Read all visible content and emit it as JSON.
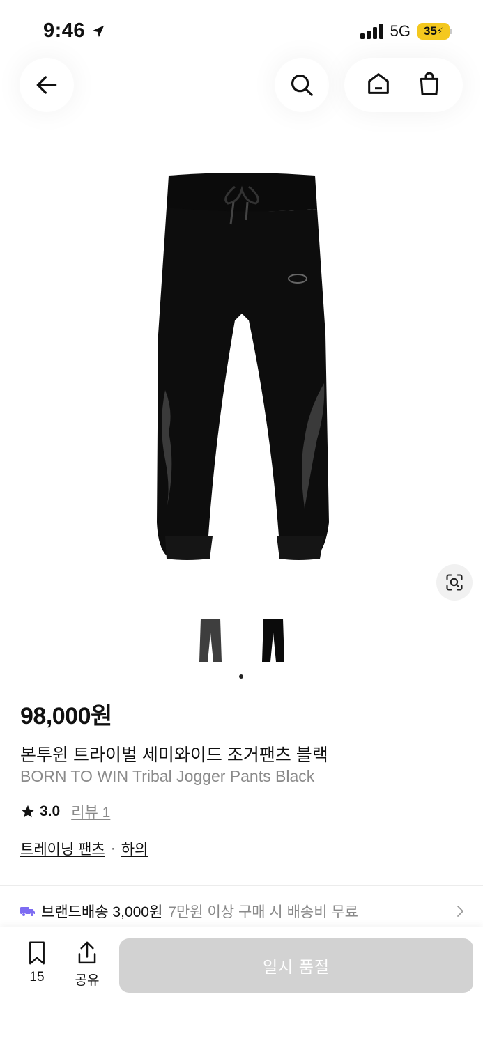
{
  "status_bar": {
    "time": "9:46",
    "network": "5G",
    "battery": "35"
  },
  "product": {
    "price": "98,000원",
    "name_ko": "본투윈 트라이벌 세미와이드 조거팬츠 블랙",
    "name_en": "BORN TO WIN Tribal Jogger Pants Black",
    "rating": "3.0",
    "review_label": "리뷰 1",
    "categories": [
      "트레이닝 팬츠",
      "하의"
    ],
    "category_separator": "·",
    "selected_thumbnail_index": 1
  },
  "shipping": {
    "label": "브랜드배송 3,000원",
    "note": "7만원 이상 구매 시 배송비 무료"
  },
  "bottom_bar": {
    "bookmark_count": "15",
    "share_label": "공유",
    "soldout_label": "일시 품절"
  },
  "icons": {
    "back": "arrow-left-icon",
    "search": "search-icon",
    "home": "home-icon",
    "cart": "shopping-bag-icon",
    "lens": "visual-search-icon",
    "bookmark": "bookmark-icon",
    "share": "share-icon"
  },
  "colors": {
    "accent_truck": "#7d6cf2",
    "battery": "#f4c81e",
    "soldout_bg": "#d2d2d2"
  }
}
